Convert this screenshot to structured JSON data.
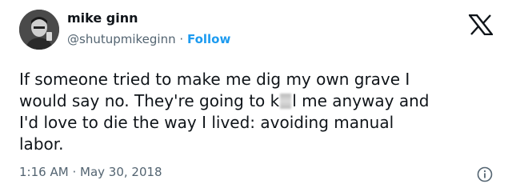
{
  "author": {
    "name": "mike ginn",
    "handle": "@shutupmikeginn",
    "separator": "·",
    "follow_label": "Follow"
  },
  "tweet": {
    "line_1": "If someone tried to make me dig my own grave I",
    "line_2_start": "would say no. They're going to k",
    "line_2_end": "l me anyway and",
    "line_3": "I'd love to die the way I lived: avoiding manual",
    "line_4": "labor."
  },
  "meta": {
    "time": "1:16 AM",
    "separator": "·",
    "date": "May 30, 2018"
  },
  "icons": {
    "logo": "x-logo-icon",
    "info": "info-icon",
    "avatar": "avatar"
  },
  "colors": {
    "text": "#0f1419",
    "secondary": "#536471",
    "accent": "#1d9bf0"
  }
}
